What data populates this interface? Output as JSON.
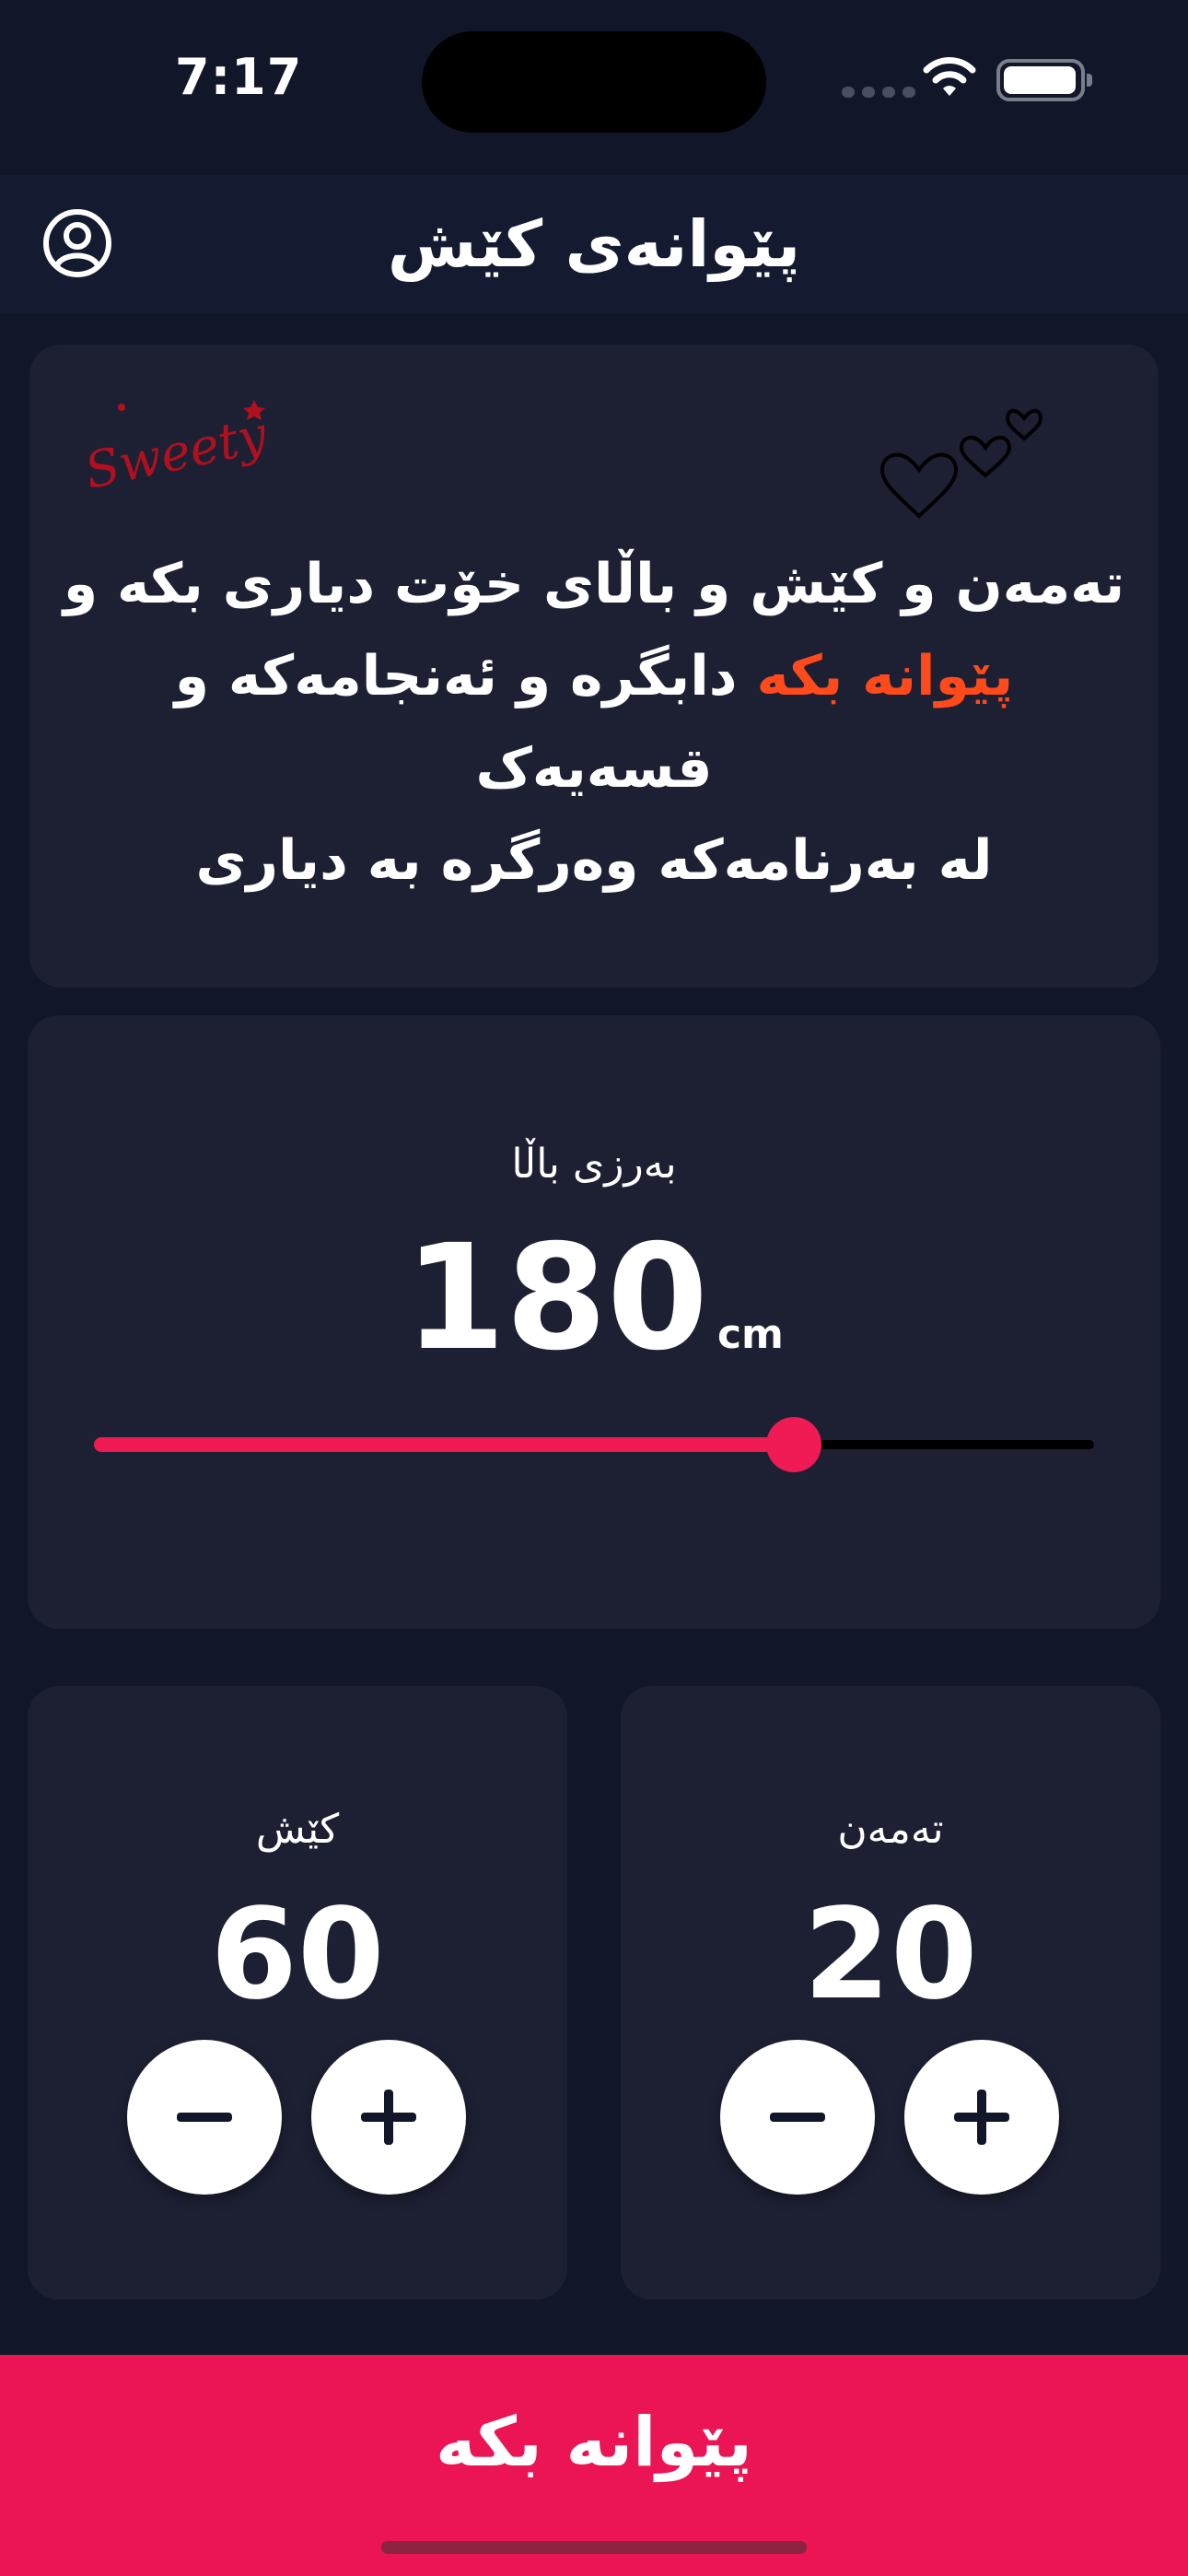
{
  "status_bar": {
    "time": "7:17"
  },
  "header": {
    "title": "پێوانەی کێش"
  },
  "info": {
    "line1": "تەمەن و کێش و باڵای خۆت دیاری بکە و",
    "highlight": "پێوانە بکە",
    "line2_rest": " دابگرە و ئەنجامەکە و قسەیەک",
    "line3": "لە بەرنامەکە وەرگرە بە دیاری",
    "decoration_text": "Sweety",
    "highlight_color": "#ff4a1c"
  },
  "height": {
    "label": "بەرزی باڵا",
    "value": "180",
    "unit": "cm",
    "slider_fraction": 0.7
  },
  "weight": {
    "label": "کێش",
    "value": "60"
  },
  "age": {
    "label": "تەمەن",
    "value": "20"
  },
  "action": {
    "label": "پێوانە بکە"
  },
  "colors": {
    "background": "#121629",
    "card": "#1d2033",
    "accent": "#eb1555",
    "slider_accent": "#f01a54"
  },
  "icons": [
    "user-circle-icon",
    "wifi-icon",
    "battery-icon",
    "minus-icon",
    "plus-icon",
    "hearts-icon"
  ]
}
